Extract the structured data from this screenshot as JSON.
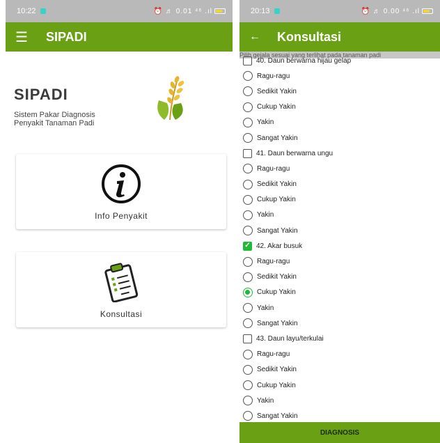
{
  "left": {
    "status": {
      "time": "10:22",
      "icons": "⏰ ♬ 0.01 ⁴⁶ .ıl"
    },
    "appbar": {
      "title": "SIPADI"
    },
    "brand": {
      "name": "SIPADI",
      "subtitle_line1": "Sistem Pakar Diagnosis",
      "subtitle_line2": "Penyakit Tanaman Padi"
    },
    "cards": [
      {
        "label": "Info Penyakit",
        "icon": "info-icon"
      },
      {
        "label": "Konsultasi",
        "icon": "clipboard-icon"
      }
    ]
  },
  "right": {
    "status": {
      "time": "20:13",
      "icons": "⏰ ♬ 0.00 ⁴⁶ .ıl"
    },
    "appbar": {
      "title": "Konsultasi"
    },
    "hint": "Pilih gejala sesuai yang terlihat pada tanaman padi",
    "rows": [
      {
        "type": "check",
        "label": "40. Daun berwarna hijau gelap",
        "checked": false
      },
      {
        "type": "radio",
        "label": "Ragu-ragu",
        "selected": false
      },
      {
        "type": "radio",
        "label": "Sedikit Yakin",
        "selected": false
      },
      {
        "type": "radio",
        "label": "Cukup Yakin",
        "selected": false
      },
      {
        "type": "radio",
        "label": "Yakin",
        "selected": false
      },
      {
        "type": "radio",
        "label": "Sangat Yakin",
        "selected": false
      },
      {
        "type": "check",
        "label": "41. Daun berwarna ungu",
        "checked": false
      },
      {
        "type": "radio",
        "label": "Ragu-ragu",
        "selected": false
      },
      {
        "type": "radio",
        "label": "Sedikit Yakin",
        "selected": false
      },
      {
        "type": "radio",
        "label": "Cukup Yakin",
        "selected": false
      },
      {
        "type": "radio",
        "label": "Yakin",
        "selected": false
      },
      {
        "type": "radio",
        "label": "Sangat Yakin",
        "selected": false
      },
      {
        "type": "check",
        "label": "42. Akar busuk",
        "checked": true
      },
      {
        "type": "radio",
        "label": "Ragu-ragu",
        "selected": false
      },
      {
        "type": "radio",
        "label": "Sedikit Yakin",
        "selected": false
      },
      {
        "type": "radio",
        "label": "Cukup Yakin",
        "selected": true
      },
      {
        "type": "radio",
        "label": "Yakin",
        "selected": false
      },
      {
        "type": "radio",
        "label": "Sangat Yakin",
        "selected": false
      },
      {
        "type": "check",
        "label": "43. Daun layu/terkulai",
        "checked": false
      },
      {
        "type": "radio",
        "label": "Ragu-ragu",
        "selected": false
      },
      {
        "type": "radio",
        "label": "Sedikit Yakin",
        "selected": false
      },
      {
        "type": "radio",
        "label": "Cukup Yakin",
        "selected": false
      },
      {
        "type": "radio",
        "label": "Yakin",
        "selected": false
      },
      {
        "type": "radio",
        "label": "Sangat Yakin",
        "selected": false
      }
    ],
    "diagnosis_button": "DIAGNOSIS"
  },
  "colors": {
    "primary": "#6aa013",
    "check": "#1fba3a",
    "statusbar": "#b9b9b9"
  }
}
